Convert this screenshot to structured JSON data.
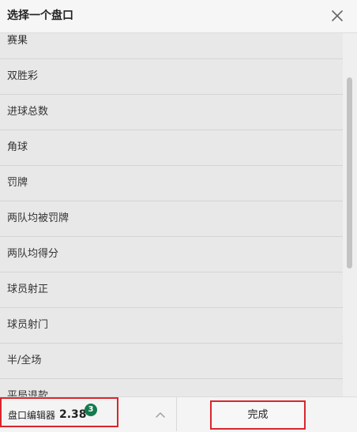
{
  "header": {
    "title": "选择一个盘口",
    "close_icon": "close-icon"
  },
  "markets": [
    "赛果",
    "双胜彩",
    "进球总数",
    "角球",
    "罚牌",
    "两队均被罚牌",
    "两队均得分",
    "球员射正",
    "球员射门",
    "半/全场",
    "平局退款"
  ],
  "footer": {
    "editor_label": "盘口编辑器",
    "editor_odds": "2.38",
    "selection_count": "3",
    "expand_icon": "chevron-up-icon",
    "done_label": "完成"
  },
  "colors": {
    "highlight_border": "#d9262c",
    "badge": "#157a4f"
  }
}
